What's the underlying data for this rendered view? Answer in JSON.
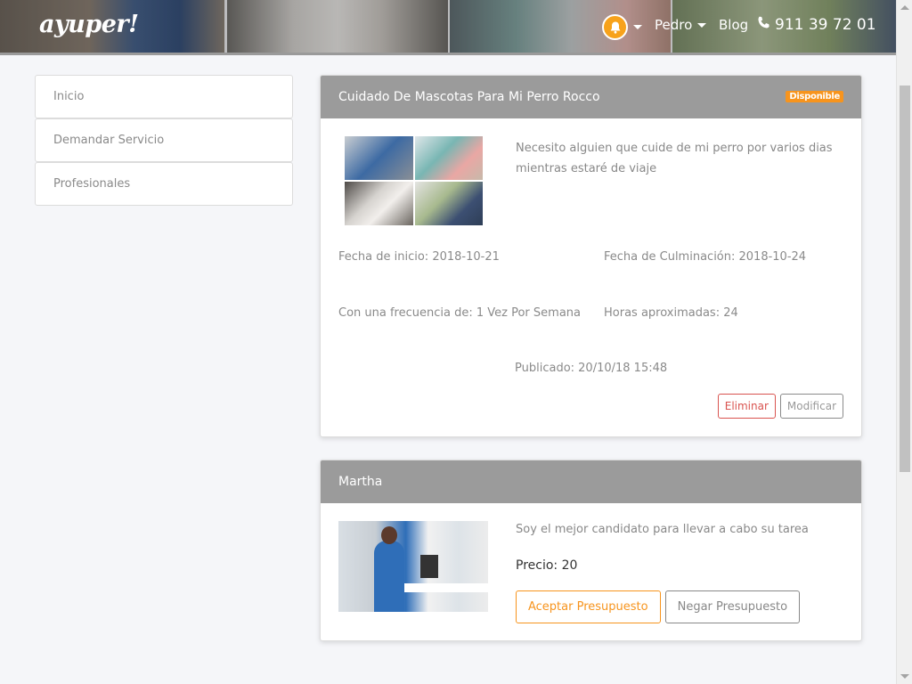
{
  "header": {
    "logo": "ayuper!",
    "user_name": "Pedro",
    "blog_label": "Blog",
    "phone": "911 39 72 01",
    "accent_color": "#f7a21b"
  },
  "sidebar": {
    "items": [
      {
        "label": "Inicio"
      },
      {
        "label": "Demandar Servicio"
      },
      {
        "label": "Profesionales"
      }
    ]
  },
  "service_card": {
    "title": "Cuidado De Mascotas Para Mi Perro Rocco",
    "status_badge": "Disponible",
    "description": "Necesito alguien que cuide de mi perro por varios dias mientras estaré de viaje",
    "start_date": "Fecha de inicio: 2018-10-21",
    "end_date": "Fecha de Culminación: 2018-10-24",
    "frequency": "Con una frecuencia de: 1 Vez Por Semana",
    "hours": "Horas aproximadas: 24",
    "published": "Publicado: 20/10/18 15:48",
    "delete_label": "Eliminar",
    "edit_label": "Modificar"
  },
  "offer_card": {
    "name": "Martha",
    "message": "Soy el mejor candidato para llevar a cabo su tarea",
    "price": "Precio: 20",
    "accept_label": "Aceptar Presupuesto",
    "reject_label": "Negar Presupuesto"
  }
}
